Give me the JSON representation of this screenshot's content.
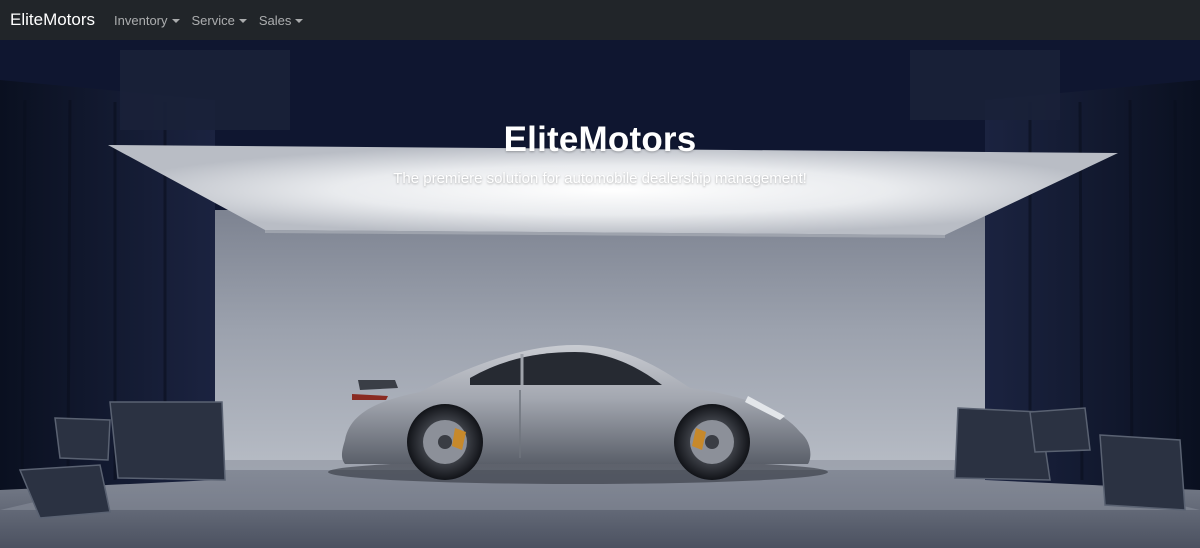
{
  "navbar": {
    "brand": "EliteMotors",
    "menus": [
      {
        "label": "Inventory"
      },
      {
        "label": "Service"
      },
      {
        "label": "Sales"
      }
    ]
  },
  "hero": {
    "title": "EliteMotors",
    "subtitle": "The premiere solution for automobile dealership management!"
  },
  "colors": {
    "navbar_bg": "#212529",
    "brand_text": "#ffffff",
    "menu_text": "#a6a8aa",
    "hero_bg": "#0d1428"
  }
}
